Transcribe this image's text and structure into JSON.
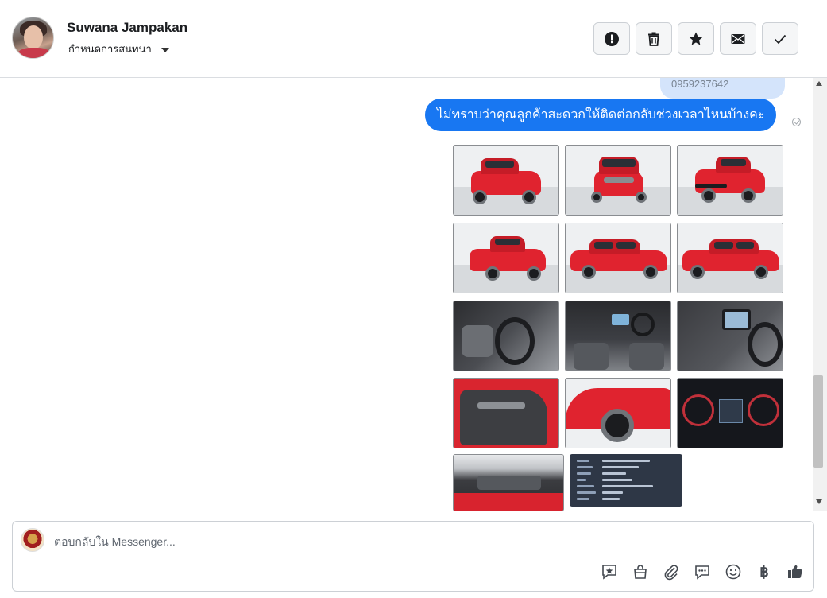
{
  "header": {
    "contact_name": "Suwana Jampakan",
    "assign_label": "กำหนดการสนทนา",
    "actions": [
      {
        "name": "report-button",
        "icon": "exclamation-icon"
      },
      {
        "name": "delete-button",
        "icon": "trash-icon"
      },
      {
        "name": "star-button",
        "icon": "star-icon"
      },
      {
        "name": "mark-unread-button",
        "icon": "envelope-icon"
      },
      {
        "name": "mark-done-button",
        "icon": "check-icon"
      }
    ]
  },
  "thread": {
    "previous_message_text": "0959237642",
    "outgoing_message": "ไม่ทราบว่าคุณลูกค้าสะดวกให้ติดต่อกลับช่วงเวลาไหนบ้างคะ",
    "seen_icon": "check-circle-icon",
    "photos": [
      {
        "label": "car-front-left"
      },
      {
        "label": "car-front"
      },
      {
        "label": "car-rear-left"
      },
      {
        "label": "car-rear-right"
      },
      {
        "label": "car-side-right"
      },
      {
        "label": "car-side-right-2"
      },
      {
        "label": "interior-gear"
      },
      {
        "label": "interior-dashboard"
      },
      {
        "label": "interior-console"
      },
      {
        "label": "door-panel"
      },
      {
        "label": "front-wheel"
      },
      {
        "label": "gauge-cluster"
      },
      {
        "label": "engine-bay"
      },
      {
        "label": "spec-sheet"
      }
    ]
  },
  "composer": {
    "placeholder": "ตอบกลับใน Messenger...",
    "tools": [
      "saved-reply-icon",
      "shop-bag-icon",
      "attachment-icon",
      "chat-bubble-icon",
      "emoji-icon",
      "baht-icon",
      "thumbs-up-icon"
    ]
  },
  "colors": {
    "accent": "#1877f2",
    "previous_bubble": "#d4e4fb",
    "border": "#ccd0d5"
  }
}
